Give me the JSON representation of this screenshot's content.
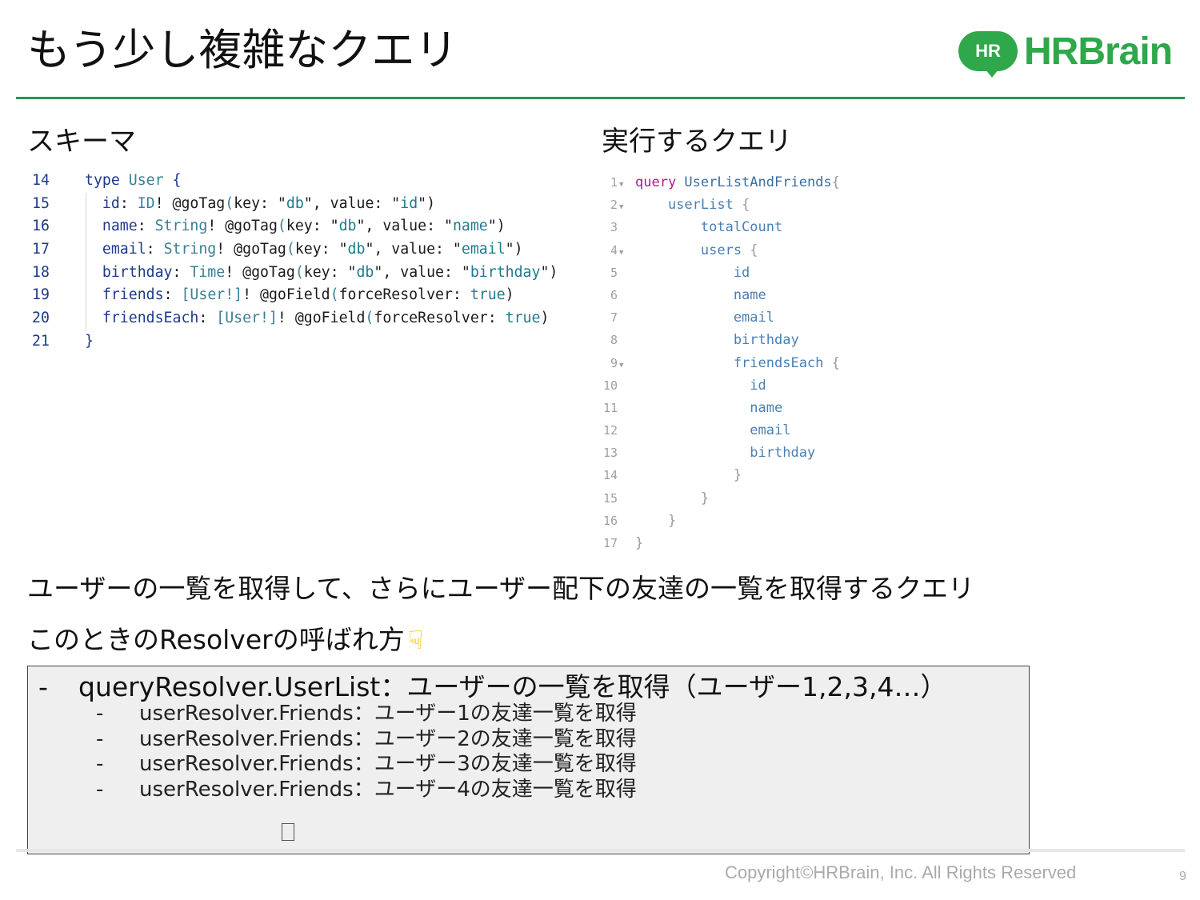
{
  "slide": {
    "title": "もう少し複雑なクエリ",
    "logo": {
      "mark_text": "HR",
      "word_text": "HRBrain",
      "color": "#2ea84a"
    },
    "accent_color": "#1f9a58"
  },
  "schema": {
    "heading": "スキーマ",
    "lines": [
      {
        "num": "14",
        "tokens": [
          {
            "t": "type",
            "c": "kw-blue"
          },
          {
            "t": " User ",
            "c": "ty-teal"
          },
          {
            "t": "{",
            "c": "kw-blue"
          }
        ]
      },
      {
        "num": "15",
        "tokens": [
          {
            "t": "  id",
            "c": "kw-blue"
          },
          {
            "t": ": ",
            "c": "dir-dark"
          },
          {
            "t": "ID",
            "c": "ty-teal"
          },
          {
            "t": "! @goTag",
            "c": "dir-dark"
          },
          {
            "t": "(",
            "c": "ty-teal"
          },
          {
            "t": "key: \"",
            "c": "dir-dark"
          },
          {
            "t": "db",
            "c": "str-teal"
          },
          {
            "t": "\", value: \"",
            "c": "dir-dark"
          },
          {
            "t": "id",
            "c": "str-teal"
          },
          {
            "t": "\")",
            "c": "dir-dark"
          }
        ]
      },
      {
        "num": "16",
        "tokens": [
          {
            "t": "  name",
            "c": "kw-blue"
          },
          {
            "t": ": ",
            "c": "dir-dark"
          },
          {
            "t": "String",
            "c": "ty-teal"
          },
          {
            "t": "! @goTag",
            "c": "dir-dark"
          },
          {
            "t": "(",
            "c": "ty-teal"
          },
          {
            "t": "key: \"",
            "c": "dir-dark"
          },
          {
            "t": "db",
            "c": "str-teal"
          },
          {
            "t": "\", value: \"",
            "c": "dir-dark"
          },
          {
            "t": "name",
            "c": "str-teal"
          },
          {
            "t": "\")",
            "c": "dir-dark"
          }
        ]
      },
      {
        "num": "17",
        "tokens": [
          {
            "t": "  email",
            "c": "kw-blue"
          },
          {
            "t": ": ",
            "c": "dir-dark"
          },
          {
            "t": "String",
            "c": "ty-teal"
          },
          {
            "t": "! @goTag",
            "c": "dir-dark"
          },
          {
            "t": "(",
            "c": "ty-teal"
          },
          {
            "t": "key: \"",
            "c": "dir-dark"
          },
          {
            "t": "db",
            "c": "str-teal"
          },
          {
            "t": "\", value: \"",
            "c": "dir-dark"
          },
          {
            "t": "email",
            "c": "str-teal"
          },
          {
            "t": "\")",
            "c": "dir-dark"
          }
        ]
      },
      {
        "num": "18",
        "tokens": [
          {
            "t": "  birthday",
            "c": "kw-blue"
          },
          {
            "t": ": ",
            "c": "dir-dark"
          },
          {
            "t": "Time",
            "c": "ty-teal"
          },
          {
            "t": "! @goTag",
            "c": "dir-dark"
          },
          {
            "t": "(",
            "c": "ty-teal"
          },
          {
            "t": "key: \"",
            "c": "dir-dark"
          },
          {
            "t": "db",
            "c": "str-teal"
          },
          {
            "t": "\", value: \"",
            "c": "dir-dark"
          },
          {
            "t": "birthday",
            "c": "str-teal"
          },
          {
            "t": "\")",
            "c": "dir-dark"
          }
        ]
      },
      {
        "num": "19",
        "tokens": [
          {
            "t": "  friends",
            "c": "kw-blue"
          },
          {
            "t": ": ",
            "c": "dir-dark"
          },
          {
            "t": "[User!]",
            "c": "ty-teal"
          },
          {
            "t": "! @goField",
            "c": "dir-dark"
          },
          {
            "t": "(",
            "c": "ty-teal"
          },
          {
            "t": "forceResolver: ",
            "c": "dir-dark"
          },
          {
            "t": "true",
            "c": "str-teal"
          },
          {
            "t": ")",
            "c": "dir-dark"
          }
        ]
      },
      {
        "num": "20",
        "tokens": [
          {
            "t": "  friendsEach",
            "c": "kw-blue"
          },
          {
            "t": ": ",
            "c": "dir-dark"
          },
          {
            "t": "[User!]",
            "c": "ty-teal"
          },
          {
            "t": "! @goField",
            "c": "dir-dark"
          },
          {
            "t": "(",
            "c": "ty-teal"
          },
          {
            "t": "forceResolver: ",
            "c": "dir-dark"
          },
          {
            "t": "true",
            "c": "str-teal"
          },
          {
            "t": ")",
            "c": "dir-dark"
          }
        ]
      },
      {
        "num": "21",
        "tokens": [
          {
            "t": "}",
            "c": "kw-blue"
          }
        ]
      }
    ]
  },
  "query": {
    "heading": "実行するクエリ",
    "lines": [
      {
        "num": "1",
        "fold": "▼",
        "tokens": [
          {
            "t": "query",
            "c": "q-kw"
          },
          {
            "t": " UserListAndFriends",
            "c": "q-name"
          },
          {
            "t": "{",
            "c": "q-brace"
          }
        ]
      },
      {
        "num": "2",
        "fold": "▼",
        "tokens": [
          {
            "t": "    userList ",
            "c": "q-field"
          },
          {
            "t": "{",
            "c": "q-brace"
          }
        ]
      },
      {
        "num": "3",
        "fold": "",
        "tokens": [
          {
            "t": "        totalCount",
            "c": "q-field"
          }
        ]
      },
      {
        "num": "4",
        "fold": "▼",
        "tokens": [
          {
            "t": "        users ",
            "c": "q-field"
          },
          {
            "t": "{",
            "c": "q-brace"
          }
        ]
      },
      {
        "num": "5",
        "fold": "",
        "tokens": [
          {
            "t": "            id",
            "c": "q-field"
          }
        ]
      },
      {
        "num": "6",
        "fold": "",
        "tokens": [
          {
            "t": "            name",
            "c": "q-field"
          }
        ]
      },
      {
        "num": "7",
        "fold": "",
        "tokens": [
          {
            "t": "            email",
            "c": "q-field"
          }
        ]
      },
      {
        "num": "8",
        "fold": "",
        "tokens": [
          {
            "t": "            birthday",
            "c": "q-field"
          }
        ]
      },
      {
        "num": "9",
        "fold": "▼",
        "tokens": [
          {
            "t": "            friendsEach ",
            "c": "q-field"
          },
          {
            "t": "{",
            "c": "q-brace"
          }
        ]
      },
      {
        "num": "10",
        "fold": "",
        "tokens": [
          {
            "t": "              id",
            "c": "q-field"
          }
        ]
      },
      {
        "num": "11",
        "fold": "",
        "tokens": [
          {
            "t": "              name",
            "c": "q-field"
          }
        ]
      },
      {
        "num": "12",
        "fold": "",
        "tokens": [
          {
            "t": "              email",
            "c": "q-field"
          }
        ]
      },
      {
        "num": "13",
        "fold": "",
        "tokens": [
          {
            "t": "              birthday",
            "c": "q-field"
          }
        ]
      },
      {
        "num": "14",
        "fold": "",
        "tokens": [
          {
            "t": "            }",
            "c": "q-brace"
          }
        ]
      },
      {
        "num": "15",
        "fold": "",
        "tokens": [
          {
            "t": "        }",
            "c": "q-brace"
          }
        ]
      },
      {
        "num": "16",
        "fold": "",
        "tokens": [
          {
            "t": "    }",
            "c": "q-brace"
          }
        ]
      },
      {
        "num": "17",
        "fold": "",
        "tokens": [
          {
            "t": "}",
            "c": "q-brace"
          }
        ]
      }
    ]
  },
  "description": "ユーザーの一覧を取得して、さらにユーザー配下の友達の一覧を取得するクエリ",
  "call_order": {
    "heading": "このときのResolverの呼ばれ方",
    "pointing_icon": "pointing-down-hand",
    "bullet": "-",
    "root": "queryResolver.UserList：ユーザーの一覧を取得（ユーザー1,2,3,4…）",
    "children": [
      "userResolver.Friends：ユーザー1の友達一覧を取得",
      "userResolver.Friends：ユーザー2の友達一覧を取得",
      "userResolver.Friends：ユーザー3の友達一覧を取得",
      "userResolver.Friends：ユーザー4の友達一覧を取得"
    ]
  },
  "footer": {
    "copyright": "Copyright©HRBrain, Inc. All Rights Reserved",
    "page_number": "9"
  }
}
